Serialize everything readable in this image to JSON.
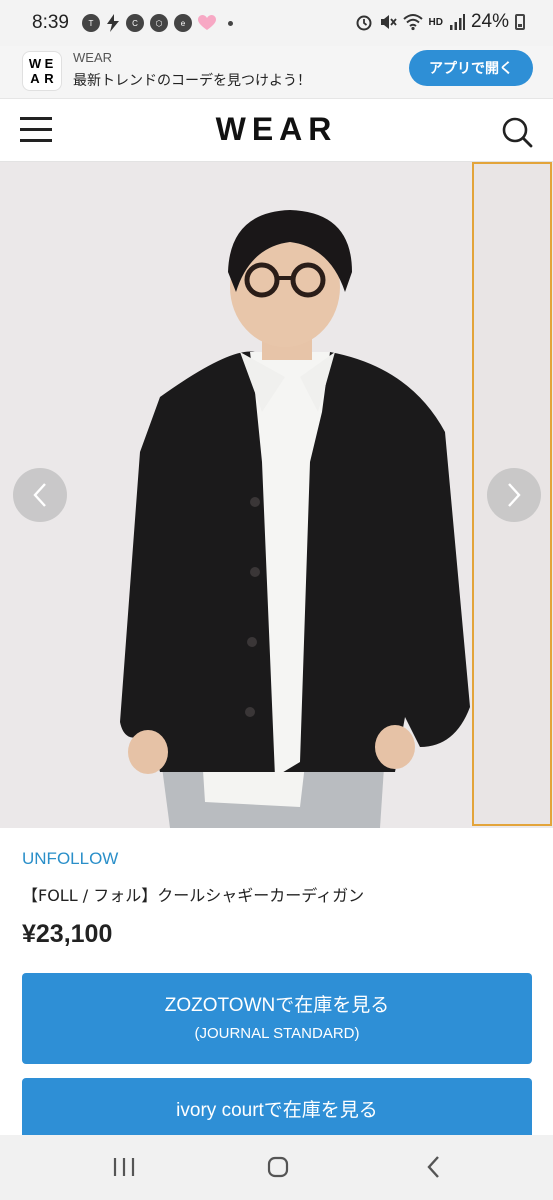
{
  "status_bar": {
    "time": "8:39",
    "battery": "24%",
    "network": "HD",
    "left_icons": [
      "talk-icon",
      "bolt-icon",
      "c-icon",
      "hexagon-icon",
      "eats-icon",
      "heart-icon",
      "dot-icon"
    ],
    "right_icons": [
      "alarm-icon",
      "mute-icon",
      "wifi-icon",
      "signal-icon",
      "battery-icon"
    ]
  },
  "app_banner": {
    "logo_letters": [
      "W",
      "E",
      "A",
      "R"
    ],
    "app_name": "WEAR",
    "tagline": "最新トレンドのコーデを見つけよう！",
    "open_button": "アプリで開く"
  },
  "header": {
    "wordmark": "WEAR"
  },
  "product": {
    "brand": "UNFOLLOW",
    "name": "【FOLL / フォル】クールシャギーカーディガン",
    "price": "¥23,100"
  },
  "stock_buttons": [
    {
      "label": "ZOZOTOWNで在庫を見る",
      "sub": "(JOURNAL STANDARD)"
    },
    {
      "label": "ivory courtで在庫を見る"
    }
  ],
  "colors": {
    "accent": "#2e8fd6",
    "brand_link": "#2a8fc9",
    "thumb_border": "#e3a43a"
  }
}
